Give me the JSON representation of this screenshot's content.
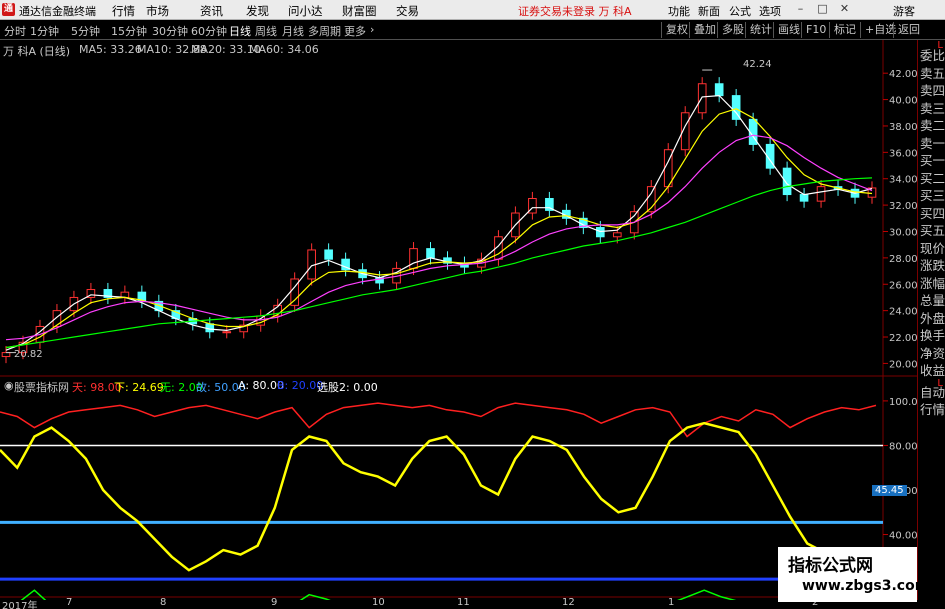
{
  "app": {
    "title": "通达信金融终端",
    "menus": [
      "行情",
      "市场",
      "资讯",
      "发现",
      "问小达",
      "财富圈",
      "交易"
    ],
    "notice": "证券交易未登录 万 科A",
    "right_menus": [
      "功能",
      "新面",
      "公式",
      "选项"
    ],
    "guest": "游客",
    "window_buttons": [
      "–",
      "□",
      "✕"
    ]
  },
  "toolbar": {
    "periods": [
      "分时",
      "1分钟",
      "5分钟",
      "15分钟",
      "30分钟",
      "60分钟",
      "日线",
      "周线",
      "月线",
      "多周期",
      "更多"
    ],
    "active_period": "日线",
    "right_buttons": [
      "复权",
      "叠加",
      "多股",
      "统计",
      "画线",
      "F10",
      "标记",
      "+自选",
      "返回"
    ]
  },
  "stock": {
    "name": "万 科A (日线)",
    "ma": [
      {
        "label": "MA5: 33.26",
        "color": "#ffffff"
      },
      {
        "label": "MA10: 32.88",
        "color": "#ffff00"
      },
      {
        "label": "MA20: 33.10",
        "color": "#ff40ff"
      },
      {
        "label": "MA60: 34.06",
        "color": "#00ff00"
      }
    ],
    "high_label": "42.24",
    "low_label": "20.82"
  },
  "indicator": {
    "name": "股票指标网",
    "items": [
      {
        "label": "天: 98.00",
        "color": "#ff3030"
      },
      {
        "label": "下: 24.69",
        "color": "#ffff00"
      },
      {
        "label": "无: 2.00",
        "color": "#00ff00"
      },
      {
        "label": "故: 50.00",
        "color": "#40a0ff"
      },
      {
        "label": "A: 80.00",
        "color": "#ffffff"
      },
      {
        "label": "B: 20.00",
        "color": "#2040ff"
      },
      {
        "label": "选股2: 0.00",
        "color": "#ffffff"
      }
    ],
    "level_label": "45.45"
  },
  "right_tabs": [
    "委比",
    "卖五",
    "卖四",
    "卖三",
    "卖二",
    "卖一",
    "买一",
    "买二",
    "买三",
    "买四",
    "买五",
    "现价",
    "涨跌",
    "涨幅",
    "总量",
    "外盘",
    "换手",
    "净资",
    "收益"
  ],
  "right_tabs_lower": [
    "自动",
    "行情"
  ],
  "date_labels": [
    "2017年",
    "7",
    "8",
    "9",
    "10",
    "11",
    "12",
    "1",
    "2"
  ],
  "watermark": {
    "line1": "指标公式网",
    "line2": "www.zbgs3.com"
  },
  "chart_data": [
    {
      "type": "candlestick",
      "title": "万 科A (日线)",
      "ylim": [
        19.5,
        43.0
      ],
      "y_ticks": [
        20.0,
        22.0,
        24.0,
        26.0,
        28.0,
        30.0,
        32.0,
        34.0,
        36.0,
        38.0,
        40.0,
        42.0
      ],
      "x_months": [
        "7",
        "8",
        "9",
        "10",
        "11",
        "12",
        "1",
        "2"
      ],
      "close": [
        20.82,
        21.6,
        22.8,
        24.0,
        25.0,
        25.6,
        25.0,
        25.4,
        24.7,
        24.0,
        23.4,
        23.0,
        22.4,
        22.4,
        22.9,
        23.6,
        24.4,
        26.4,
        28.6,
        27.9,
        27.1,
        26.5,
        26.1,
        27.2,
        28.7,
        28.0,
        27.6,
        27.3,
        27.9,
        29.6,
        31.4,
        32.5,
        31.6,
        31.0,
        30.3,
        29.6,
        29.9,
        31.5,
        33.4,
        36.2,
        39.0,
        41.2,
        40.3,
        38.5,
        36.6,
        34.8,
        32.8,
        32.3,
        33.4,
        33.2,
        32.6,
        33.3
      ],
      "high": 42.24,
      "low": 20.82,
      "ma_series": [
        {
          "name": "MA5",
          "color": "#ffffff",
          "values": [
            21.0,
            21.5,
            22.4,
            23.5,
            24.5,
            25.2,
            25.1,
            25.0,
            24.6,
            24.0,
            23.4,
            22.9,
            22.6,
            22.5,
            22.8,
            23.4,
            24.3,
            25.8,
            27.4,
            27.8,
            27.3,
            26.8,
            26.5,
            26.9,
            27.6,
            28.0,
            27.7,
            27.5,
            27.8,
            28.9,
            30.5,
            31.8,
            31.8,
            31.2,
            30.5,
            30.0,
            30.1,
            31.2,
            32.9,
            35.3,
            38.0,
            40.2,
            40.3,
            39.0,
            37.2,
            35.4,
            33.6,
            32.8,
            33.0,
            33.2,
            32.9,
            33.26
          ]
        },
        {
          "name": "MA10",
          "color": "#ffff00",
          "values": [
            21.2,
            21.4,
            22.0,
            22.9,
            23.8,
            24.6,
            24.9,
            25.0,
            24.8,
            24.4,
            23.9,
            23.4,
            23.0,
            22.8,
            22.8,
            23.1,
            23.7,
            24.8,
            26.1,
            26.9,
            27.0,
            26.9,
            26.7,
            26.8,
            27.2,
            27.6,
            27.7,
            27.6,
            27.7,
            28.3,
            29.3,
            30.5,
            31.1,
            31.2,
            30.9,
            30.5,
            30.3,
            30.7,
            31.8,
            33.4,
            35.5,
            37.6,
            38.9,
            39.3,
            38.6,
            37.2,
            35.6,
            34.3,
            33.6,
            33.3,
            33.0,
            32.88
          ]
        },
        {
          "name": "MA20",
          "color": "#ff40ff",
          "values": [
            21.8,
            21.9,
            22.2,
            22.7,
            23.3,
            23.9,
            24.3,
            24.6,
            24.7,
            24.6,
            24.4,
            24.1,
            23.8,
            23.5,
            23.3,
            23.3,
            23.5,
            24.0,
            24.7,
            25.4,
            25.9,
            26.2,
            26.4,
            26.6,
            26.9,
            27.2,
            27.4,
            27.5,
            27.6,
            27.9,
            28.5,
            29.2,
            29.8,
            30.2,
            30.4,
            30.5,
            30.5,
            30.7,
            31.3,
            32.2,
            33.4,
            34.8,
            36.0,
            36.9,
            37.3,
            37.1,
            36.5,
            35.6,
            34.8,
            34.1,
            33.6,
            33.1
          ]
        },
        {
          "name": "MA60",
          "color": "#00ff00",
          "values": [
            21.2,
            21.4,
            21.6,
            21.8,
            22.0,
            22.2,
            22.4,
            22.6,
            22.8,
            23.0,
            23.1,
            23.2,
            23.3,
            23.4,
            23.5,
            23.6,
            23.8,
            24.0,
            24.3,
            24.6,
            24.9,
            25.2,
            25.4,
            25.6,
            25.9,
            26.2,
            26.5,
            26.8,
            27.0,
            27.3,
            27.6,
            28.0,
            28.3,
            28.6,
            28.9,
            29.1,
            29.3,
            29.6,
            29.9,
            30.3,
            30.7,
            31.2,
            31.7,
            32.2,
            32.7,
            33.1,
            33.4,
            33.6,
            33.8,
            33.9,
            34.0,
            34.06
          ]
        }
      ]
    },
    {
      "type": "line",
      "title": "股票指标网",
      "ylim": [
        16,
        104
      ],
      "y_ticks": [
        20.0,
        40.0,
        60.0,
        80.0,
        100.0
      ],
      "hlines": [
        {
          "value": 80.0,
          "color": "#ffffff"
        },
        {
          "value": 45.45,
          "color": "#40b0ff"
        },
        {
          "value": 20.0,
          "color": "#2040ff"
        }
      ],
      "series": [
        {
          "name": "天",
          "color": "#ff2020",
          "values": [
            95,
            93,
            88,
            92,
            95,
            96,
            97,
            98,
            96,
            93,
            95,
            97,
            98,
            96,
            94,
            92,
            95,
            97,
            88,
            94,
            97,
            98,
            99,
            98,
            97,
            98,
            96,
            95,
            93,
            97,
            99,
            98,
            97,
            96,
            94,
            90,
            93,
            96,
            97,
            95,
            84,
            90,
            93,
            91,
            96,
            94,
            88,
            92,
            95,
            97,
            96,
            98
          ]
        },
        {
          "name": "下",
          "color": "#ffff00",
          "values": [
            78,
            70,
            84,
            88,
            82,
            74,
            60,
            52,
            46,
            38,
            30,
            24,
            28,
            33,
            31,
            35,
            52,
            78,
            84,
            82,
            72,
            68,
            66,
            62,
            74,
            82,
            84,
            76,
            62,
            58,
            74,
            84,
            82,
            78,
            66,
            56,
            50,
            52,
            66,
            82,
            88,
            90,
            88,
            86,
            76,
            62,
            48,
            36,
            32,
            30,
            26,
            24.69
          ]
        },
        {
          "name": "无",
          "color": "#00ff00",
          "values": [
            6,
            9,
            15,
            8,
            6,
            4,
            5,
            3,
            5,
            4,
            6,
            4,
            5,
            3,
            6,
            4,
            5,
            8,
            13,
            11,
            8,
            6,
            4,
            5,
            5,
            7,
            5,
            4,
            6,
            5,
            4,
            6,
            5,
            7,
            6,
            5,
            4,
            5,
            6,
            9,
            12,
            15,
            12,
            10,
            7,
            5,
            6,
            5,
            3,
            4,
            3,
            2
          ]
        }
      ]
    }
  ]
}
